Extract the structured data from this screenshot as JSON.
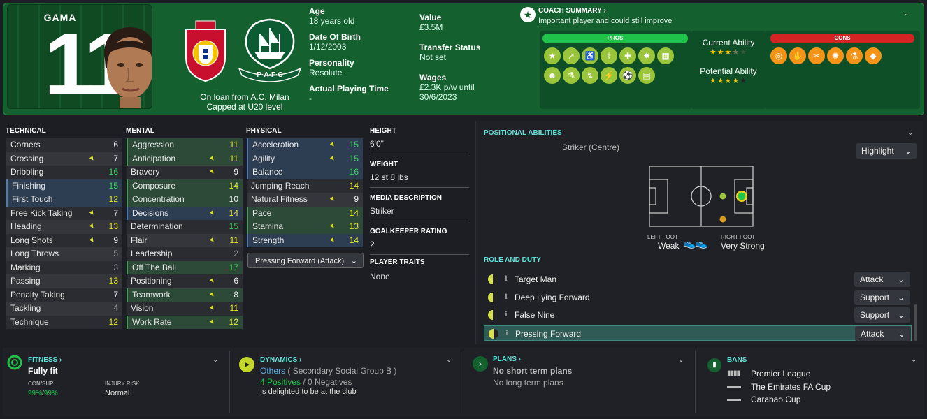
{
  "player": {
    "name": "GAMA",
    "number": "11",
    "loan_line1": "On loan from A.C. Milan",
    "loan_line2": "Capped at U20 level"
  },
  "details": {
    "age_label": "Age",
    "age": "18 years old",
    "dob_label": "Date Of Birth",
    "dob": "1/12/2003",
    "personality_label": "Personality",
    "personality": "Resolute",
    "apt_label": "Actual Playing Time",
    "apt": "-",
    "value_label": "Value",
    "value": "£3.5M",
    "transfer_label": "Transfer Status",
    "transfer": "Not set",
    "wages_label": "Wages",
    "wages1": "£2.3K p/w until",
    "wages2": "30/6/2023"
  },
  "coach": {
    "title": "COACH SUMMARY ›",
    "text": "Important player and could still improve",
    "pros": "PROS",
    "cons": "CONS",
    "current_label": "Current Ability",
    "current_stars": 3.5,
    "potential_label": "Potential Ability",
    "potential_stars": 4,
    "pros_icons_row1": [
      "star-icon",
      "trend-icon",
      "accessibility-icon",
      "bone-icon",
      "handshake-icon",
      "burst-icon",
      "pitch-icon"
    ],
    "pros_icons_row2": [
      "head-icon",
      "bottle-icon",
      "tackle-icon",
      "kick-icon",
      "goal-icon",
      "document-icon"
    ],
    "cons_icons": [
      "target-icon",
      "foot-icon",
      "tactics-icon",
      "shot-icon",
      "flask-icon",
      "tag-icon"
    ],
    "pros_glyphs1": [
      "★",
      "↗",
      "♿",
      "⚕",
      "✚",
      "✸",
      "▦"
    ],
    "pros_glyphs2": [
      "☻",
      "⚗",
      "↯",
      "⚡",
      "⚽",
      "▤"
    ],
    "cons_glyphs": [
      "◎",
      "✋",
      "✂",
      "✺",
      "⚗",
      "◆"
    ],
    "colors": {
      "pros": "#1fc34a",
      "cons": "#d42323",
      "pro_icon": "#9ac43a",
      "con_icon": "#f39318"
    }
  },
  "technical": {
    "title": "TECHNICAL",
    "rows": [
      {
        "name": "Corners",
        "value": "6",
        "c": "w",
        "bg": "dark"
      },
      {
        "name": "Crossing",
        "value": "7",
        "c": "w",
        "bg": "light",
        "arrow": true
      },
      {
        "name": "Dribbling",
        "value": "16",
        "c": "gr",
        "bg": "dark"
      },
      {
        "name": "Finishing",
        "value": "15",
        "c": "gr",
        "bg": "blu",
        "hl": "bl"
      },
      {
        "name": "First Touch",
        "value": "12",
        "c": "y",
        "bg": "blu",
        "hl": "bl"
      },
      {
        "name": "Free Kick Taking",
        "value": "7",
        "c": "w",
        "bg": "dark",
        "arrow": true
      },
      {
        "name": "Heading",
        "value": "13",
        "c": "y",
        "bg": "light",
        "arrow": true
      },
      {
        "name": "Long Shots",
        "value": "9",
        "c": "w",
        "bg": "dark",
        "arrow": true
      },
      {
        "name": "Long Throws",
        "value": "5",
        "c": "gy",
        "bg": "light"
      },
      {
        "name": "Marking",
        "value": "3",
        "c": "gy",
        "bg": "dark"
      },
      {
        "name": "Passing",
        "value": "13",
        "c": "y",
        "bg": "light"
      },
      {
        "name": "Penalty Taking",
        "value": "7",
        "c": "w",
        "bg": "dark"
      },
      {
        "name": "Tackling",
        "value": "4",
        "c": "gy",
        "bg": "light"
      },
      {
        "name": "Technique",
        "value": "12",
        "c": "y",
        "bg": "dark"
      }
    ]
  },
  "mental": {
    "title": "MENTAL",
    "rows": [
      {
        "name": "Aggression",
        "value": "11",
        "c": "y",
        "bg": "grn",
        "hl": "gl"
      },
      {
        "name": "Anticipation",
        "value": "11",
        "c": "y",
        "bg": "grn",
        "hl": "gl",
        "arrow": true
      },
      {
        "name": "Bravery",
        "value": "9",
        "c": "w",
        "bg": "dark",
        "arrow": true
      },
      {
        "name": "Composure",
        "value": "14",
        "c": "y",
        "bg": "grn",
        "hl": "gl"
      },
      {
        "name": "Concentration",
        "value": "10",
        "c": "w",
        "bg": "grn",
        "hl": "gl"
      },
      {
        "name": "Decisions",
        "value": "14",
        "c": "y",
        "bg": "blu",
        "hl": "bl",
        "arrow": true
      },
      {
        "name": "Determination",
        "value": "15",
        "c": "gr",
        "bg": "dark"
      },
      {
        "name": "Flair",
        "value": "11",
        "c": "y",
        "bg": "light",
        "arrow": true
      },
      {
        "name": "Leadership",
        "value": "2",
        "c": "gy",
        "bg": "dark"
      },
      {
        "name": "Off The Ball",
        "value": "17",
        "c": "gr",
        "bg": "grn",
        "hl": "gl"
      },
      {
        "name": "Positioning",
        "value": "6",
        "c": "w",
        "bg": "dark",
        "arrow": true
      },
      {
        "name": "Teamwork",
        "value": "8",
        "c": "w",
        "bg": "grn",
        "hl": "gl",
        "arrow": true
      },
      {
        "name": "Vision",
        "value": "11",
        "c": "y",
        "bg": "dark",
        "arrow": true
      },
      {
        "name": "Work Rate",
        "value": "12",
        "c": "y",
        "bg": "grn",
        "hl": "gl",
        "arrow": true
      }
    ]
  },
  "physical": {
    "title": "PHYSICAL",
    "rows": [
      {
        "name": "Acceleration",
        "value": "15",
        "c": "gr",
        "bg": "blu",
        "hl": "bl",
        "arrow": true
      },
      {
        "name": "Agility",
        "value": "15",
        "c": "gr",
        "bg": "blu",
        "hl": "bl",
        "arrow": true
      },
      {
        "name": "Balance",
        "value": "16",
        "c": "gr",
        "bg": "blu",
        "hl": "bl"
      },
      {
        "name": "Jumping Reach",
        "value": "14",
        "c": "y",
        "bg": "dark"
      },
      {
        "name": "Natural Fitness",
        "value": "9",
        "c": "w",
        "bg": "light",
        "arrow": true
      },
      {
        "name": "Pace",
        "value": "14",
        "c": "y",
        "bg": "grn",
        "hl": "gl"
      },
      {
        "name": "Stamina",
        "value": "13",
        "c": "y",
        "bg": "grn",
        "hl": "gl",
        "arrow": true
      },
      {
        "name": "Strength",
        "value": "14",
        "c": "y",
        "bg": "blu",
        "hl": "bl",
        "arrow": true
      }
    ],
    "role_select": "Pressing Forward (Attack)"
  },
  "info": {
    "height_label": "HEIGHT",
    "height": "6'0\"",
    "weight_label": "WEIGHT",
    "weight": "12 st 8 lbs",
    "media_label": "MEDIA DESCRIPTION",
    "media": "Striker",
    "gk_label": "GOALKEEPER RATING",
    "gk": "2",
    "traits_label": "PLAYER TRAITS",
    "traits": "None"
  },
  "positional": {
    "title": "POSITIONAL ABILITIES",
    "position": "Striker (Centre)",
    "highlight": "Highlight",
    "left_foot_label": "LEFT FOOT",
    "left_foot": "Weak",
    "right_foot_label": "RIGHT FOOT",
    "right_foot": "Very Strong"
  },
  "roles": {
    "title": "ROLE AND DUTY",
    "rows": [
      {
        "name": "Target Man",
        "duty": "Attack"
      },
      {
        "name": "Deep Lying Forward",
        "duty": "Support"
      },
      {
        "name": "False Nine",
        "duty": "Support"
      },
      {
        "name": "Pressing Forward",
        "duty": "Attack"
      }
    ]
  },
  "bottom": {
    "fitness_title": "FITNESS ›",
    "fitness": "Fully fit",
    "conshp_label": "CON/SHP",
    "conshp": "99%",
    "conshp2": "99%",
    "injury_label": "INJURY RISK",
    "injury": "Normal",
    "dynamics_title": "DYNAMICS ›",
    "group": "Others",
    "group_sub": "( Secondary Social Group B )",
    "positives": "4 Positives",
    "negatives": "/ 0 Negatives",
    "happy": "Is delighted to be at the club",
    "plans_title": "PLANS ›",
    "plan1": "No short term plans",
    "plan2": "No long term plans",
    "bans_title": "BANS",
    "ban1": "Premier League",
    "ban2": "The Emirates FA Cup",
    "ban3": "Carabao Cup"
  }
}
